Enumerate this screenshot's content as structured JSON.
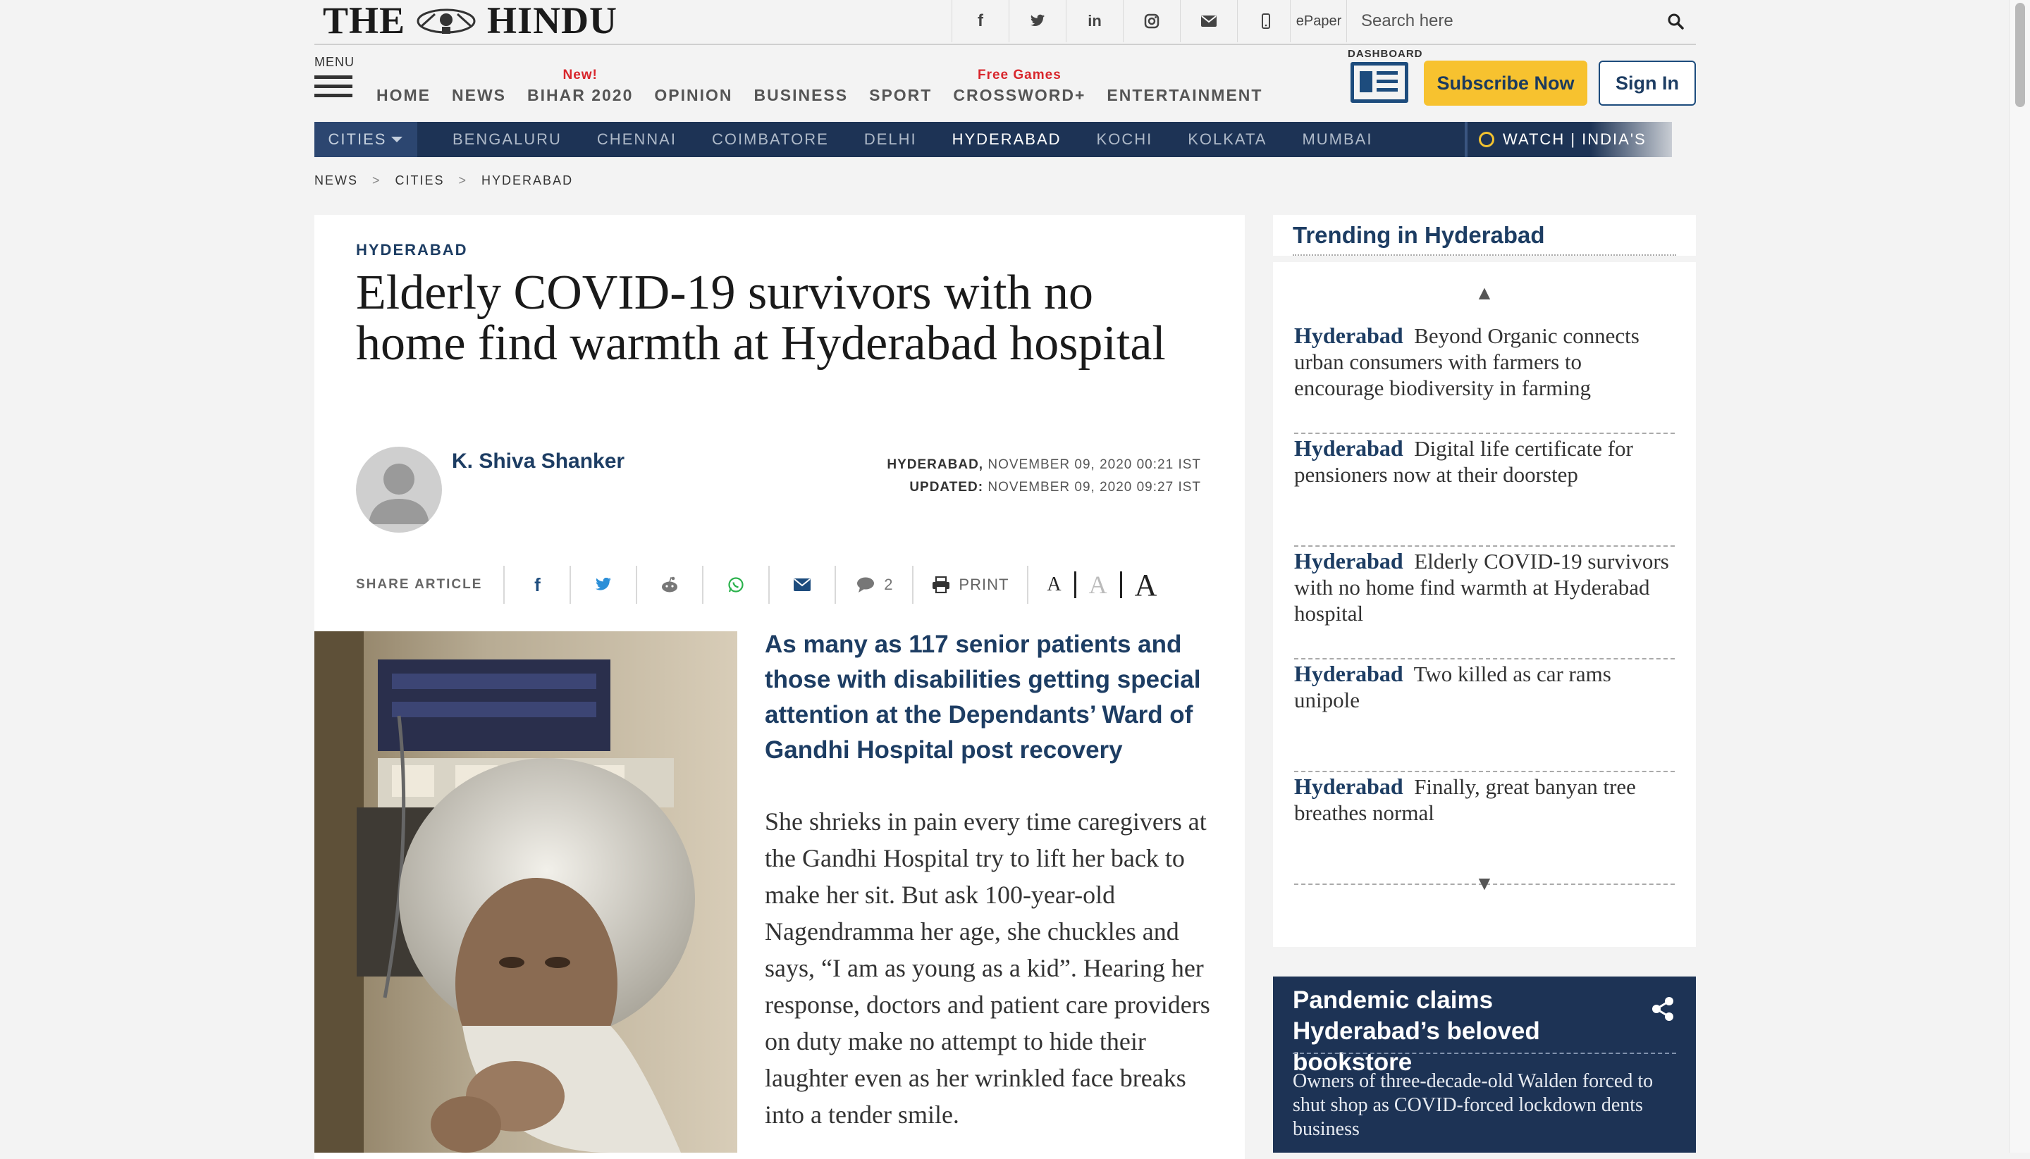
{
  "masthead": {
    "logo_text_left": "THE",
    "logo_text_right": "HINDU",
    "social_icons": [
      "facebook-icon",
      "twitter-icon",
      "linkedin-icon",
      "instagram-icon",
      "mail-icon",
      "mobile-icon"
    ],
    "social_glyphs": [
      "f",
      "🐦",
      "in",
      "◎",
      "✉",
      "▯"
    ],
    "epaper_label": "ePaper",
    "search_placeholder": "Search here"
  },
  "nav": {
    "menu_label": "MENU",
    "items": [
      {
        "label": "HOME",
        "tag": ""
      },
      {
        "label": "NEWS",
        "tag": ""
      },
      {
        "label": "BIHAR 2020",
        "tag": "New!"
      },
      {
        "label": "OPINION",
        "tag": ""
      },
      {
        "label": "BUSINESS",
        "tag": ""
      },
      {
        "label": "SPORT",
        "tag": ""
      },
      {
        "label": "CROSSWORD+",
        "tag": "Free Games"
      },
      {
        "label": "ENTERTAINMENT",
        "tag": ""
      }
    ],
    "dashboard_label": "DASHBOARD",
    "subscribe_label": "Subscribe Now",
    "signin_label": "Sign In"
  },
  "cities": {
    "head_label": "CITIES",
    "items": [
      "BENGALURU",
      "CHENNAI",
      "COIMBATORE",
      "DELHI",
      "HYDERABAD",
      "KOCHI",
      "KOLKATA",
      "MUMBAI"
    ],
    "active": "HYDERABAD",
    "watch_label": "WATCH | INDIA'S"
  },
  "breadcrumb": [
    "NEWS",
    "CITIES",
    "HYDERABAD"
  ],
  "article": {
    "section": "HYDERABAD",
    "headline": "Elderly COVID-19 survivors with no home find warmth at Hyderabad hospital",
    "author": "K. Shiva Shanker",
    "dateline_place": "HYDERABAD,",
    "dateline_date": "NOVEMBER 09, 2020 00:21 IST",
    "updated_label": "UPDATED:",
    "updated_date": "NOVEMBER 09, 2020 09:27 IST",
    "share_label": "SHARE ARTICLE",
    "comment_count": "2",
    "print_label": "PRINT",
    "font_sizes": [
      "A",
      "A",
      "A"
    ],
    "summary": "As many as 117 senior patients and those with disabilities getting special attention at the Dependants’ Ward of Gandhi Hospital post recovery",
    "body": "She shrieks in pain every time caregivers at the Gandhi Hospital try to lift her back to make her sit. But ask 100-year-old Nagendramma her age, she chuckles and says, “I am as young as a kid”. Hearing her response, doctors and patient care providers on duty make no attempt to hide their laughter even as her wrinkled face breaks into a tender smile."
  },
  "trending": {
    "title": "Trending in Hyderabad",
    "items": [
      {
        "city": "Hyderabad",
        "text": "Beyond Organic connects urban consumers with farmers to encourage biodiversity in farming"
      },
      {
        "city": "Hyderabad",
        "text": "Digital life certificate for pensioners now at their doorstep"
      },
      {
        "city": "Hyderabad",
        "text": "Elderly COVID-19 survivors with no home find warmth at Hyderabad hospital"
      },
      {
        "city": "Hyderabad",
        "text": "Two killed as car rams unipole"
      },
      {
        "city": "Hyderabad",
        "text": "Finally, great banyan tree breathes normal"
      }
    ]
  },
  "promo": {
    "title": "Pandemic claims Hyderabad’s beloved bookstore",
    "description": "Owners of three-decade-old Walden forced to shut shop as COVID-forced lockdown dents business"
  },
  "colors": {
    "brand_navy": "#1d3355",
    "link_blue": "#1d3d63",
    "subscribe_yellow": "#f7c22f",
    "tag_red": "#d8262c"
  }
}
